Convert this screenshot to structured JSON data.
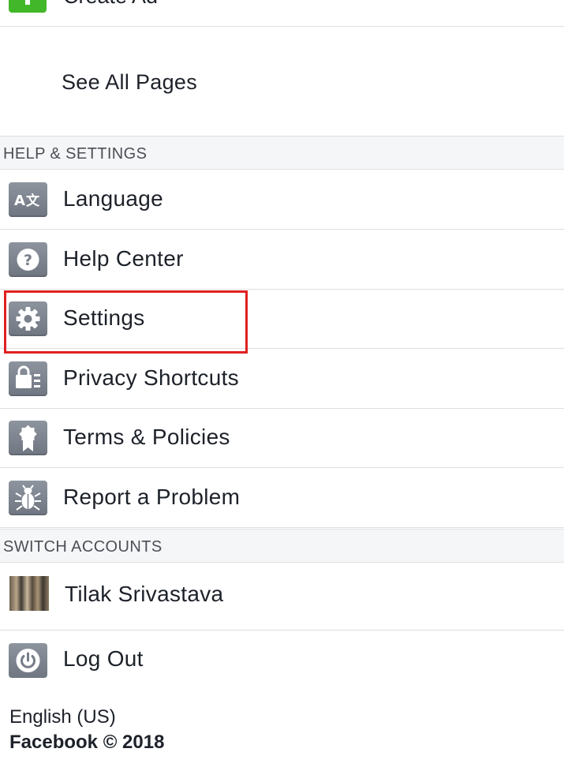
{
  "top_item": {
    "label": "Create Ad"
  },
  "see_all_pages": {
    "label": "See All Pages"
  },
  "help_section": {
    "header": "HELP & SETTINGS",
    "items": [
      {
        "label": "Language",
        "icon": "language-icon"
      },
      {
        "label": "Help Center",
        "icon": "help-icon"
      },
      {
        "label": "Settings",
        "icon": "gear-icon",
        "highlighted": true
      },
      {
        "label": "Privacy Shortcuts",
        "icon": "lock-list-icon"
      },
      {
        "label": "Terms & Policies",
        "icon": "ribbon-badge-icon"
      },
      {
        "label": "Report a Problem",
        "icon": "bug-icon"
      }
    ]
  },
  "switch_section": {
    "header": "SWITCH ACCOUNTS",
    "account": {
      "name": "Tilak Srivastava"
    }
  },
  "logout": {
    "label": "Log Out",
    "icon": "power-icon"
  },
  "footer": {
    "language": "English (US)",
    "brand": "Facebook",
    "copyright": "© 2018"
  },
  "colors": {
    "icon_gray": "#7f8691",
    "highlight_red": "#e02020",
    "green_icon": "#42b72a",
    "section_bg": "#f5f6f7",
    "divider": "#dddfe2"
  }
}
